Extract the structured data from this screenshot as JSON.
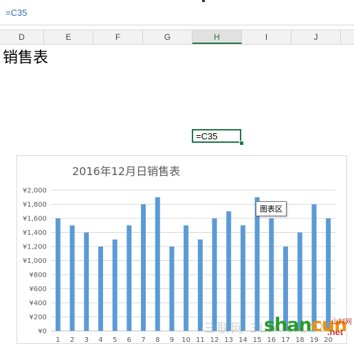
{
  "formula_bar": {
    "formula": "=C35"
  },
  "columns": [
    {
      "label": "D",
      "selected": false
    },
    {
      "label": "E",
      "selected": false
    },
    {
      "label": "F",
      "selected": false
    },
    {
      "label": "G",
      "selected": false
    },
    {
      "label": "H",
      "selected": true
    },
    {
      "label": "I",
      "selected": false
    },
    {
      "label": "J",
      "selected": false
    }
  ],
  "sheet": {
    "title": "销售表",
    "active_cell_value": "=C35"
  },
  "tooltip": {
    "text": "图表区"
  },
  "watermark": {
    "text": "三联网 3LIAN.COM"
  },
  "logo": {
    "text_main": "shan",
    "text_accent": "cun",
    "text_sub": "山村网",
    "text_net": ".net"
  },
  "colors": {
    "bar": "#5b9bd5",
    "selection": "#217346",
    "formula": "#2e6eb6"
  },
  "chart_data": {
    "type": "bar",
    "title": "2016年12月日销售表",
    "categories": [
      "1",
      "2",
      "3",
      "4",
      "5",
      "6",
      "7",
      "8",
      "9",
      "10",
      "11",
      "12",
      "13",
      "14",
      "15",
      "16",
      "17",
      "18",
      "19",
      "20"
    ],
    "values": [
      1600,
      1500,
      1400,
      1200,
      1300,
      1500,
      1800,
      1900,
      1200,
      1500,
      1300,
      1600,
      1700,
      1500,
      1900,
      1600,
      1200,
      1400,
      1800,
      1600
    ],
    "ylim": [
      0,
      2000
    ],
    "yticks": [
      "¥0",
      "¥200",
      "¥400",
      "¥600",
      "¥800",
      "¥1,000",
      "¥1,200",
      "¥1,400",
      "¥1,600",
      "¥1,800",
      "¥2,000"
    ],
    "grid": true,
    "legend": "none"
  }
}
